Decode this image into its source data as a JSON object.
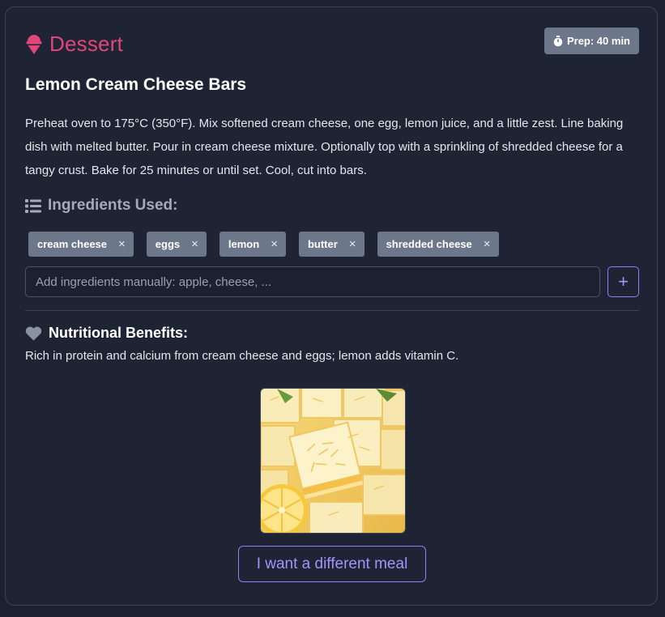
{
  "category": {
    "label": "Dessert",
    "icon": "ice-cream-icon",
    "color": "#e0467c"
  },
  "prep_badge": {
    "label": "Prep: 40 min",
    "icon": "stopwatch-icon"
  },
  "recipe": {
    "title": "Lemon Cream Cheese Bars",
    "instructions": "Preheat oven to 175°C (350°F). Mix softened cream cheese, one egg, lemon juice, and a little zest. Line baking dish with melted butter. Pour in cream cheese mixture. Optionally top with a sprinkling of shredded cheese for a tangy crust. Bake for 25 minutes or until set. Cool, cut into bars."
  },
  "ingredients": {
    "header": "Ingredients Used:",
    "icon": "list-icon",
    "tags": [
      {
        "label": "cream cheese",
        "remove": "×"
      },
      {
        "label": "eggs",
        "remove": "×"
      },
      {
        "label": "lemon",
        "remove": "×"
      },
      {
        "label": "butter",
        "remove": "×"
      },
      {
        "label": "shredded cheese",
        "remove": "×"
      }
    ],
    "input_placeholder": "Add ingredients manually: apple, cheese, ...",
    "add_label": "+"
  },
  "nutrition": {
    "header": "Nutritional Benefits:",
    "icon": "heart-icon",
    "text": "Rich in protein and calcium from cream cheese and eggs; lemon adds vitamin C."
  },
  "image": {
    "alt": "Lemon cream cheese bars"
  },
  "different_meal_label": "I want a different meal",
  "colors": {
    "accent": "#a493ff",
    "badge": "#6c7789",
    "background": "#1e2433"
  }
}
